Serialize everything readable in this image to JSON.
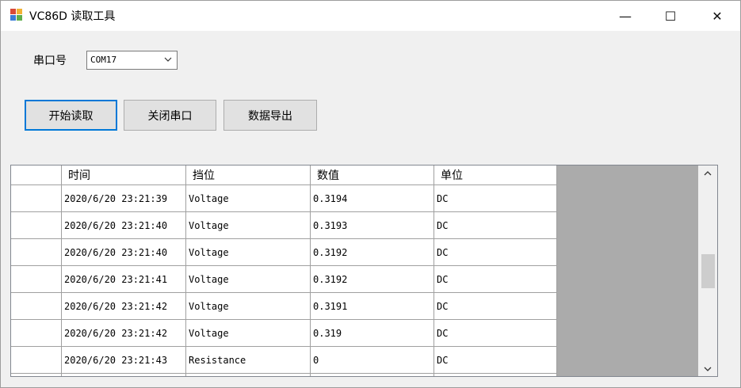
{
  "window": {
    "title": "VC86D 读取工具",
    "controls": {
      "minimize": "—",
      "maximize": "☐",
      "close": "✕"
    }
  },
  "serial": {
    "label": "串口号",
    "port_value": "COM17"
  },
  "buttons": {
    "start": "开始读取",
    "close_port": "关闭串口",
    "export": "数据导出"
  },
  "grid": {
    "columns": [
      "时间",
      "挡位",
      "数值",
      "单位"
    ],
    "rows": [
      [
        "2020/6/20 23:21:39",
        "Voltage",
        "0.3194",
        "DC"
      ],
      [
        "2020/6/20 23:21:40",
        "Voltage",
        "0.3193",
        "DC"
      ],
      [
        "2020/6/20 23:21:40",
        "Voltage",
        "0.3192",
        "DC"
      ],
      [
        "2020/6/20 23:21:41",
        "Voltage",
        "0.3192",
        "DC"
      ],
      [
        "2020/6/20 23:21:42",
        "Voltage",
        "0.3191",
        "DC"
      ],
      [
        "2020/6/20 23:21:42",
        "Voltage",
        "0.319",
        "DC"
      ],
      [
        "2020/6/20 23:21:43",
        "Resistance",
        "0",
        "DC"
      ],
      [
        "",
        "",
        "",
        ""
      ]
    ]
  },
  "colors": {
    "focus_border": "#0078d7",
    "grid_background": "#ababab",
    "window_background": "#f0f0f0"
  }
}
